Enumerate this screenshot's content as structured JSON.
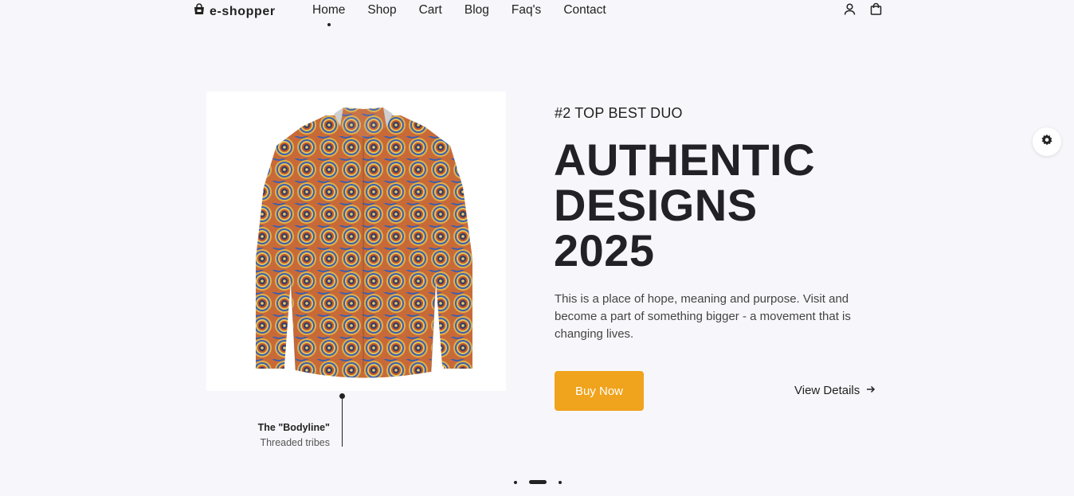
{
  "header": {
    "logo_text": "e-shopper",
    "nav": [
      {
        "label": "Home",
        "active": true
      },
      {
        "label": "Shop"
      },
      {
        "label": "Cart"
      },
      {
        "label": "Blog"
      },
      {
        "label": "Faq's"
      },
      {
        "label": "Contact"
      }
    ],
    "icons": [
      "user-icon",
      "shopping-bag-icon"
    ]
  },
  "hero": {
    "eyebrow": "#2 TOP BEST DUO",
    "headline_lines": [
      "AUTHENTIC",
      "DESIGNS",
      "2025"
    ],
    "description": "This is a place of hope, meaning and purpose. Visit and become a part of something bigger - a movement that is changing lives.",
    "buy_label": "Buy Now",
    "details_label": "View Details",
    "accent_color": "#f0a31c"
  },
  "product": {
    "caption_title": "The \"Bodyline\"",
    "caption_subtitle": "Threaded tribes"
  },
  "slider": {
    "total": 3,
    "active_index": 1
  },
  "settings_icon": "gear-icon"
}
